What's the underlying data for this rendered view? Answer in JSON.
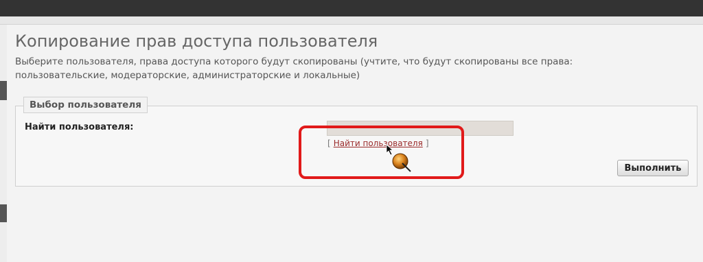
{
  "header": {
    "title": "Копирование прав доступа пользователя",
    "description": "Выберите пользователя, права доступа которого будут скопированы (учтите, что будут скопированы все права: пользовательские, модераторские, администраторские и локальные)"
  },
  "form": {
    "legend": "Выбор пользователя",
    "find_user_label": "Найти пользователя:",
    "search_value": "",
    "find_link": {
      "open_bracket": "[",
      "text": "Найти пользователя",
      "close_bracket": "]"
    },
    "submit_label": "Выполнить"
  },
  "colors": {
    "highlight": "#e11a1a",
    "link": "#9a2a2a",
    "topbar": "#333333"
  },
  "icons": {
    "cursor": "pointer-cursor-icon"
  }
}
